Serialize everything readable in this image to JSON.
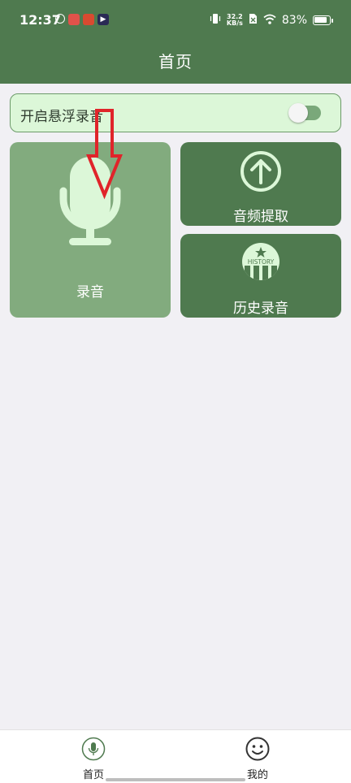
{
  "status_bar": {
    "time": "12:37",
    "net_speed_value": "32.2",
    "net_speed_unit": "KB/s",
    "battery_percent": "83%"
  },
  "header": {
    "title": "首页"
  },
  "float_toggle": {
    "label": "开启悬浮录音",
    "enabled": false
  },
  "cards": {
    "record": {
      "label": "录音"
    },
    "extract": {
      "label": "音频提取"
    },
    "history": {
      "label": "历史录音",
      "icon_text": "HISTORY"
    }
  },
  "bottom_nav": {
    "items": [
      {
        "label": "首页",
        "icon": "mic-icon",
        "active": true
      },
      {
        "label": "我的",
        "icon": "smiley-icon",
        "active": false
      }
    ]
  },
  "colors": {
    "primary": "#4f7a4f",
    "record_card": "#82ab7e",
    "toggle_bg": "#dcf7d8",
    "annotation_arrow": "#e0242a"
  }
}
